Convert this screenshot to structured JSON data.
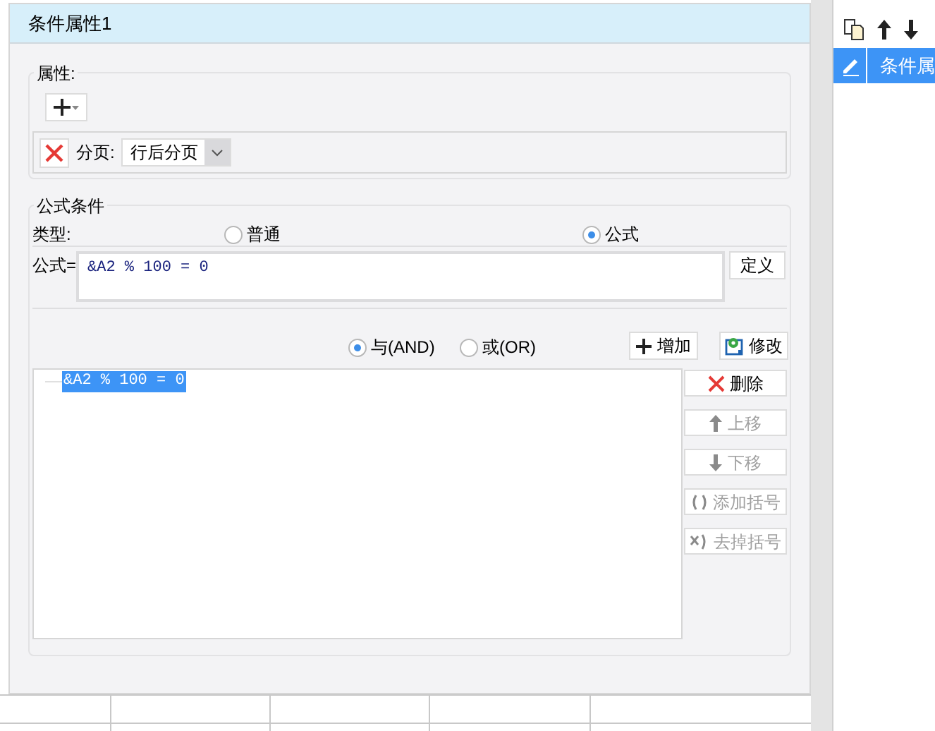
{
  "dialog": {
    "title": "条件属性1"
  },
  "properties": {
    "legend": "属性:",
    "page_break": {
      "label": "分页:",
      "value": "行后分页"
    }
  },
  "formula_condition": {
    "legend": "公式条件",
    "type_label": "类型:",
    "types": [
      {
        "label": "普通",
        "selected": false
      },
      {
        "label": "公式",
        "selected": true
      }
    ],
    "formula_label": "公式=",
    "formula": "&A2 % 100 = 0",
    "define_button": "定义",
    "logic": [
      {
        "label": "与(AND)",
        "selected": true
      },
      {
        "label": "或(OR)",
        "selected": false
      }
    ],
    "add_button": "增加",
    "edit_button": "修改",
    "conditions": [
      {
        "text": "&A2 % 100 = 0",
        "selected": true
      }
    ],
    "actions": [
      {
        "kind": "delete",
        "label": "删除",
        "disabled": false
      },
      {
        "kind": "up",
        "label": "上移",
        "disabled": true
      },
      {
        "kind": "down",
        "label": "下移",
        "disabled": true
      },
      {
        "kind": "add_brackets",
        "label": "添加括号",
        "disabled": true
      },
      {
        "kind": "remove_brackets",
        "label": "去掉括号",
        "disabled": true
      }
    ]
  },
  "right_panel": {
    "items": [
      {
        "label": "条件属",
        "selected": true
      }
    ]
  }
}
